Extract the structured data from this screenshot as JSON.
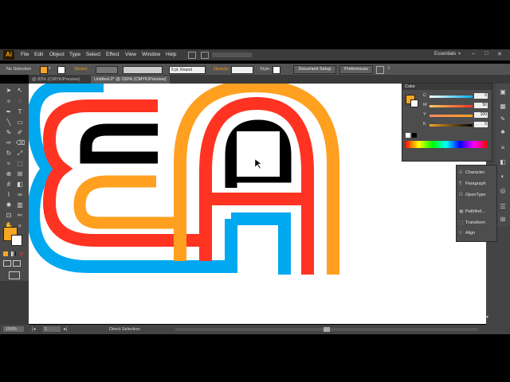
{
  "app": {
    "logo": "Ai"
  },
  "menu": [
    "File",
    "Edit",
    "Object",
    "Type",
    "Select",
    "Effect",
    "View",
    "Window",
    "Help"
  ],
  "workspace": "Essentials",
  "control_bar": {
    "selection": "No Selection",
    "stroke_label": "Stroke:",
    "brush": "5 pt. Round",
    "opacity_label": "Opacity:",
    "style_label": "Style:",
    "document_setup": "Document Setup",
    "preferences": "Preferences",
    "fill_color": "#f5a623"
  },
  "tabs": [
    {
      "label": "@ 83% (CMYK/Preview)",
      "active": false
    },
    {
      "label": "Untitled-2* @ 150% (CMYK/Preview)",
      "active": true
    }
  ],
  "color_panel": {
    "title": "Color",
    "channels": [
      {
        "label": "C",
        "value": "0"
      },
      {
        "label": "M",
        "value": "50"
      },
      {
        "label": "Y",
        "value": "100"
      },
      {
        "label": "K",
        "value": "0"
      }
    ],
    "fill_color": "#f5a623"
  },
  "side_panels": [
    "Character",
    "Paragraph",
    "OpenType",
    "Pathfind...",
    "Transform",
    "Align"
  ],
  "status": {
    "zoom": "150%",
    "page": "1",
    "tool": "Direct Selection"
  },
  "artwork_colors": {
    "blue": "#00a8f0",
    "red": "#ff3322",
    "black": "#000000",
    "orange": "#ffa020"
  }
}
